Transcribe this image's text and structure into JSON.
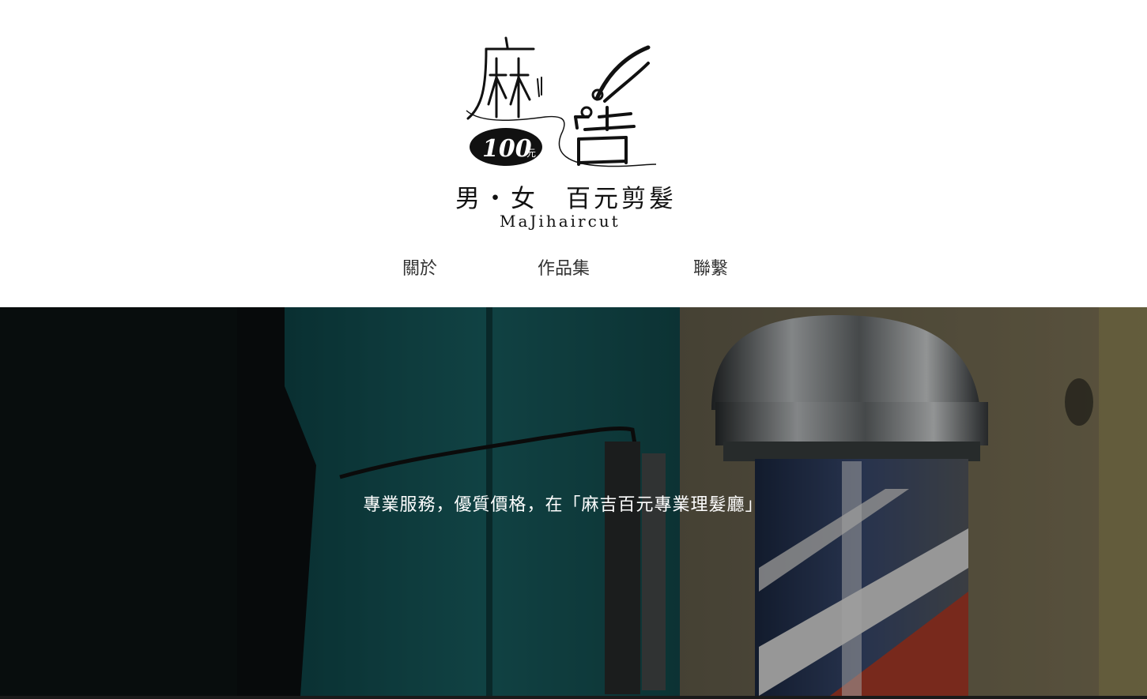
{
  "brand": {
    "logo_chars": "麻吉",
    "price_badge": "100",
    "price_badge_unit": "元",
    "tagline": "男・女　百元剪髮",
    "subtitle": "MaJihaircut"
  },
  "nav": {
    "about": "關於",
    "portfolio": "作品集",
    "contact": "聯繫"
  },
  "hero": {
    "text": "專業服務，優質價格，在「麻吉百元專業理髮廳」"
  },
  "colors": {
    "background": "#ffffff",
    "text": "#333333",
    "hero_overlay": "#0d1415",
    "hero_text": "#ffffff"
  }
}
